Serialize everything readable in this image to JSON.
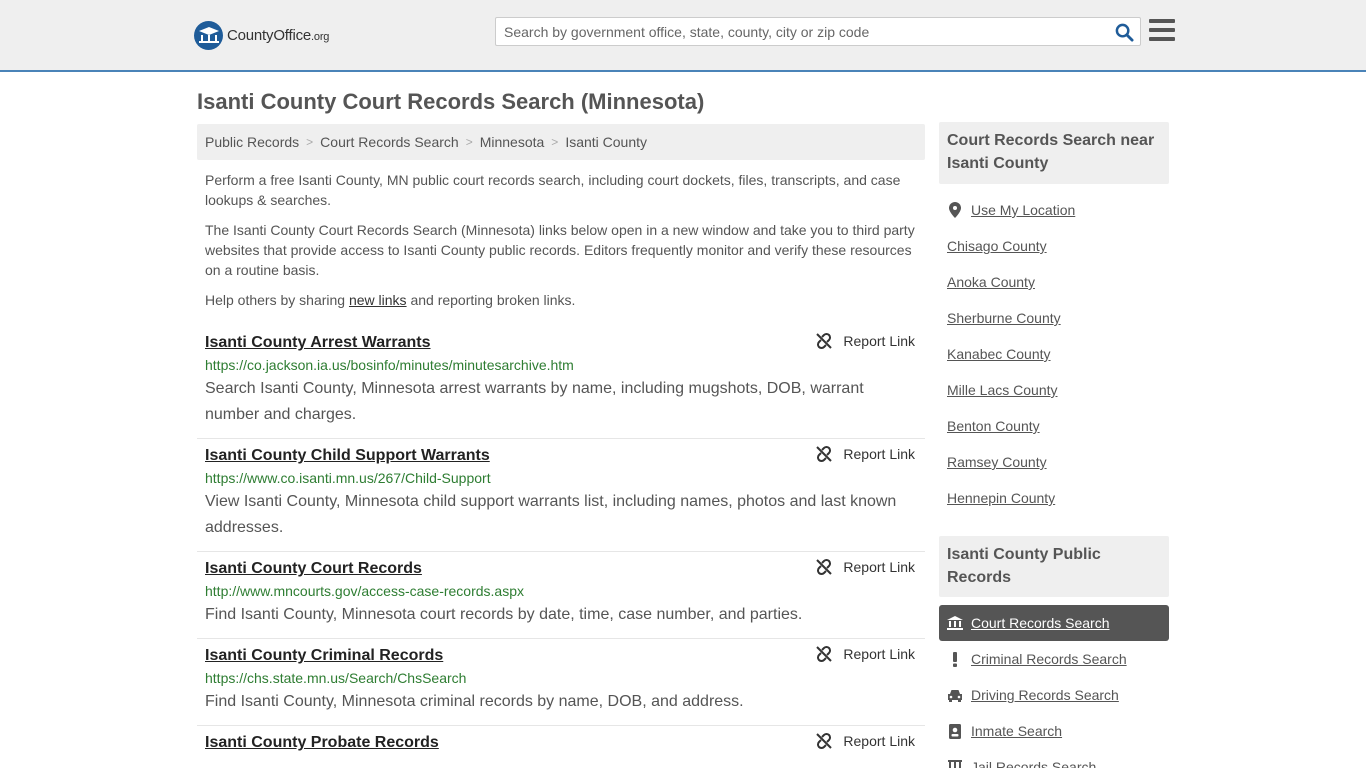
{
  "header": {
    "logo_text": "CountyOffice",
    "logo_suffix": ".org",
    "search_placeholder": "Search by government office, state, county, city or zip code"
  },
  "page_title": "Isanti County Court Records Search (Minnesota)",
  "breadcrumb": [
    "Public Records",
    "Court Records Search",
    "Minnesota",
    "Isanti County"
  ],
  "intro": {
    "p1": "Perform a free Isanti County, MN public court records search, including court dockets, files, transcripts, and case lookups & searches.",
    "p2": "The Isanti County Court Records Search (Minnesota) links below open in a new window and take you to third party websites that provide access to Isanti County public records. Editors frequently monitor and verify these resources on a routine basis.",
    "p3_before": "Help others by sharing ",
    "p3_link": "new links",
    "p3_after": " and reporting broken links."
  },
  "report_label": "Report Link",
  "results": [
    {
      "title": "Isanti County Arrest Warrants",
      "url": "https://co.jackson.ia.us/bosinfo/minutes/minutesarchive.htm",
      "desc": "Search Isanti County, Minnesota arrest warrants by name, including mugshots, DOB, warrant number and charges."
    },
    {
      "title": "Isanti County Child Support Warrants",
      "url": "https://www.co.isanti.mn.us/267/Child-Support",
      "desc": "View Isanti County, Minnesota child support warrants list, including names, photos and last known addresses."
    },
    {
      "title": "Isanti County Court Records",
      "url": "http://www.mncourts.gov/access-case-records.aspx",
      "desc": "Find Isanti County, Minnesota court records by date, time, case number, and parties."
    },
    {
      "title": "Isanti County Criminal Records",
      "url": "https://chs.state.mn.us/Search/ChsSearch",
      "desc": "Find Isanti County, Minnesota criminal records by name, DOB, and address."
    },
    {
      "title": "Isanti County Probate Records",
      "url": "",
      "desc": ""
    }
  ],
  "sidebar": {
    "nearby_title": "Court Records Search near Isanti County",
    "use_location": "Use My Location",
    "nearby": [
      "Chisago County",
      "Anoka County",
      "Sherburne County",
      "Kanabec County",
      "Mille Lacs County",
      "Benton County",
      "Ramsey County",
      "Hennepin County"
    ],
    "public_title": "Isanti County Public Records",
    "public_items": [
      {
        "label": "Court Records Search",
        "icon": "courthouse-icon"
      },
      {
        "label": "Criminal Records Search",
        "icon": "exclamation-icon"
      },
      {
        "label": "Driving Records Search",
        "icon": "car-icon"
      },
      {
        "label": "Inmate Search",
        "icon": "id-badge-icon"
      },
      {
        "label": "Jail Records Search",
        "icon": "jail-icon"
      }
    ]
  }
}
